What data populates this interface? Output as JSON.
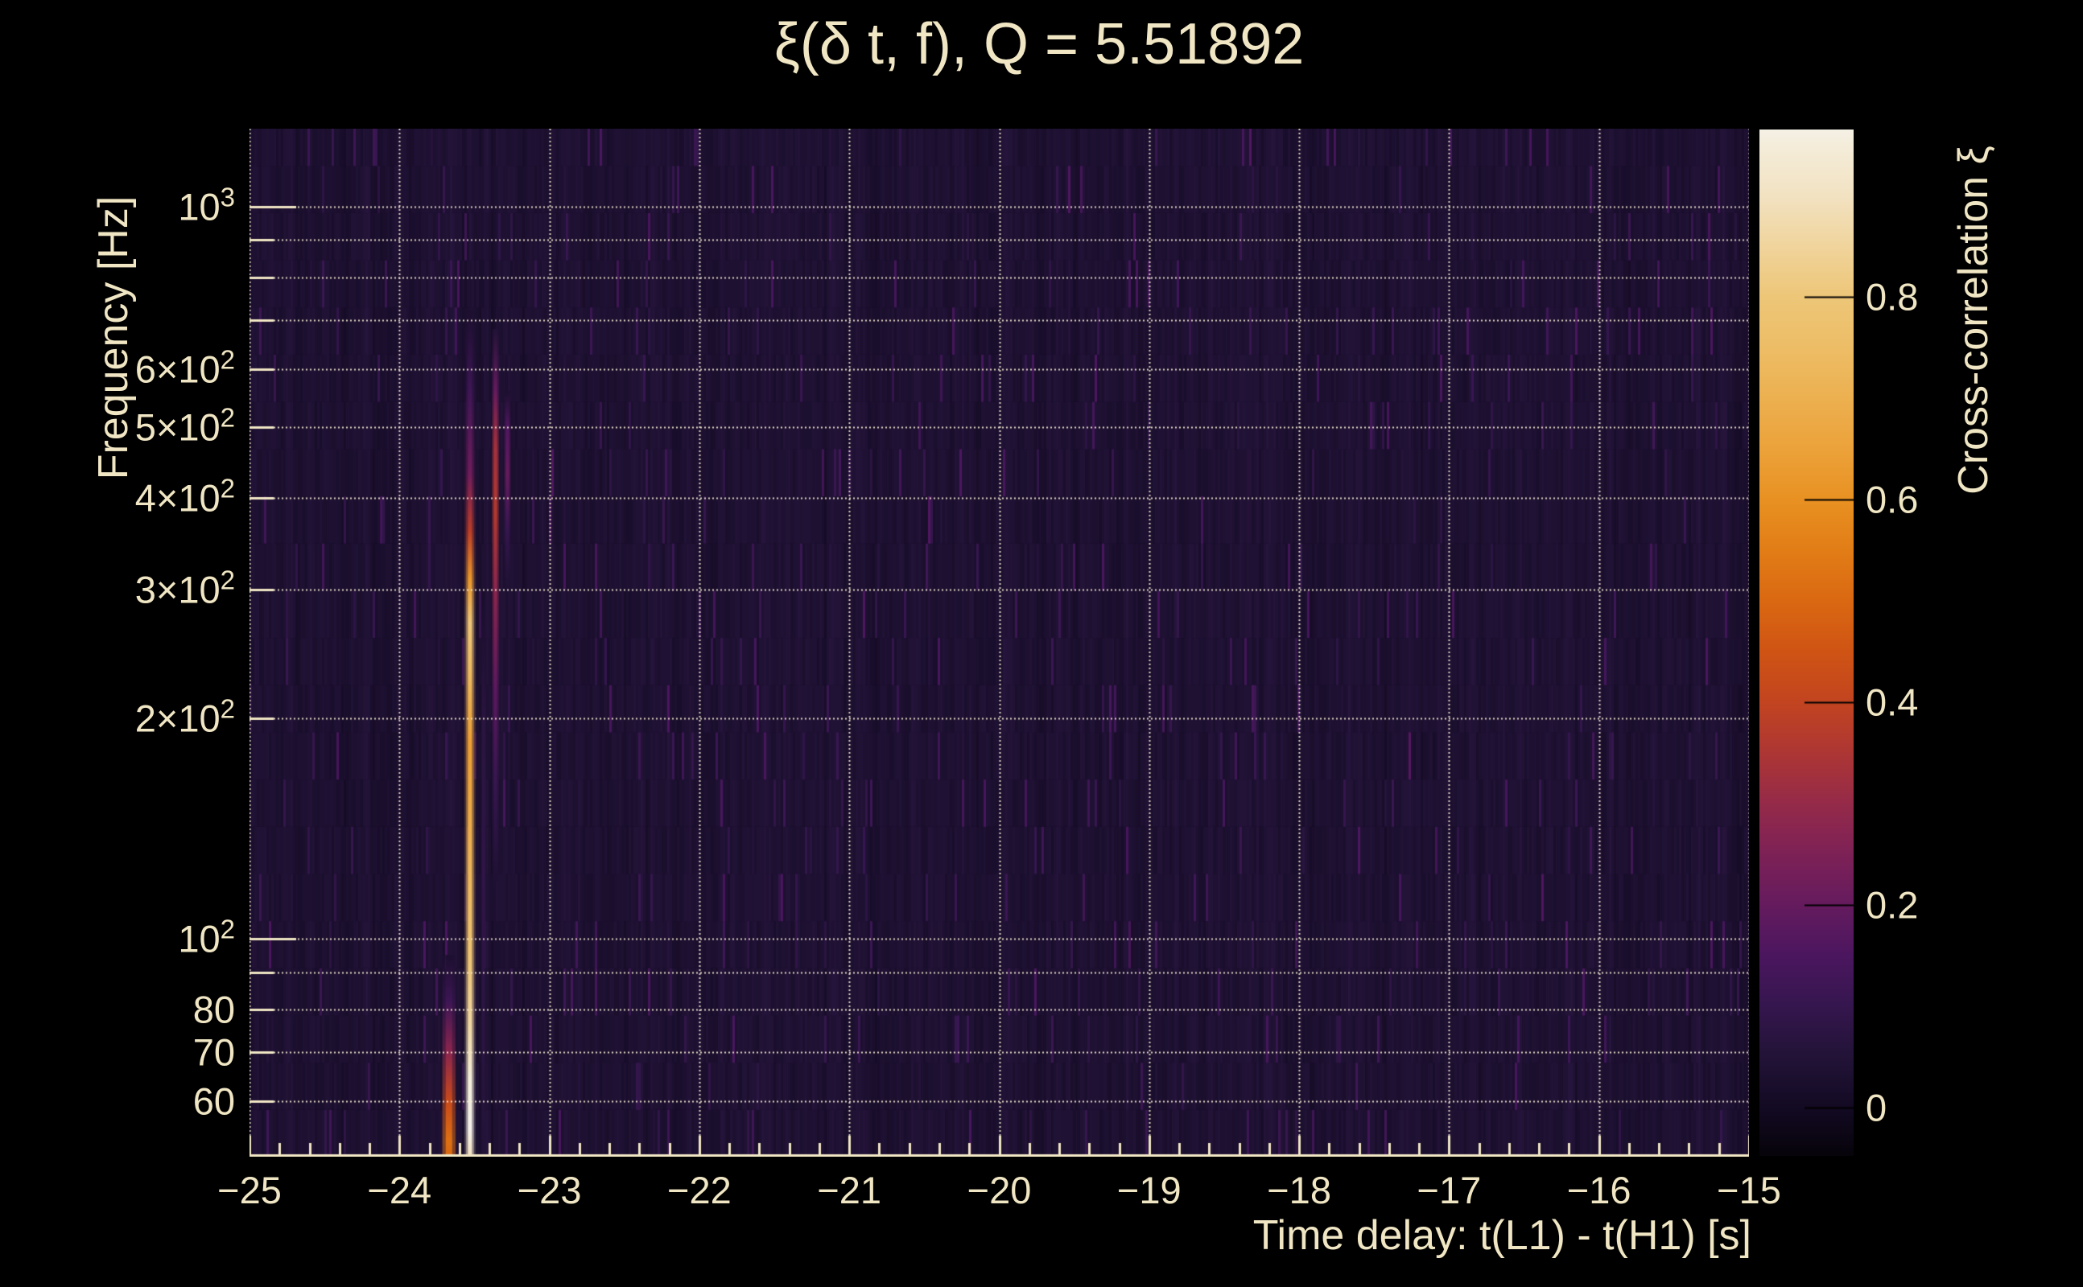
{
  "colors": {
    "background": "#000000",
    "text": "#f0e6c4",
    "grid": "#f3ead0",
    "axis": "#f0e6c4",
    "colorbar_tick": "#000000",
    "heatmap_base": "#1d1130"
  },
  "chart_data": {
    "type": "heatmap",
    "title": "ξ(δ t, f), Q = 5.51892",
    "xlabel": "Time delay: t(L1) - t(H1) [s]",
    "ylabel": "Frequency [Hz]",
    "colorbar_label": "Cross-correlation ξ",
    "x_range": [
      -25,
      -15
    ],
    "y_range_hz": [
      50.4,
      1277
    ],
    "y_scale": "log",
    "grid": true,
    "legend_position": "right-colorbar",
    "x_ticks": [
      {
        "t": -25,
        "label": "−25"
      },
      {
        "t": -24,
        "label": "−24"
      },
      {
        "t": -23,
        "label": "−23"
      },
      {
        "t": -22,
        "label": "−22"
      },
      {
        "t": -21,
        "label": "−21"
      },
      {
        "t": -20,
        "label": "−20"
      },
      {
        "t": -19,
        "label": "−19"
      },
      {
        "t": -18,
        "label": "−18"
      },
      {
        "t": -17,
        "label": "−17"
      },
      {
        "t": -16,
        "label": "−16"
      },
      {
        "t": -15,
        "label": "−15"
      }
    ],
    "x_minor_tick_step": 0.2,
    "y_ticks": [
      {
        "f": 1000,
        "base": "10",
        "exp": "3",
        "decade": true
      },
      {
        "f": 600,
        "base": "6×10",
        "exp": "2",
        "decade": false
      },
      {
        "f": 500,
        "base": "5×10",
        "exp": "2",
        "decade": false
      },
      {
        "f": 400,
        "base": "4×10",
        "exp": "2",
        "decade": false
      },
      {
        "f": 300,
        "base": "3×10",
        "exp": "2",
        "decade": false
      },
      {
        "f": 200,
        "base": "2×10",
        "exp": "2",
        "decade": false
      },
      {
        "f": 100,
        "base": "10",
        "exp": "2",
        "decade": true
      },
      {
        "f": 80,
        "base": "80",
        "exp": "",
        "decade": false
      },
      {
        "f": 70,
        "base": "70",
        "exp": "",
        "decade": false
      },
      {
        "f": 60,
        "base": "60",
        "exp": "",
        "decade": false
      }
    ],
    "y_minor_gridlines_hz": [
      90,
      700,
      800,
      900
    ],
    "colorbar_ticks": [
      {
        "v": 0.8,
        "label": "0.8"
      },
      {
        "v": 0.6,
        "label": "0.6"
      },
      {
        "v": 0.4,
        "label": "0.4"
      },
      {
        "v": 0.2,
        "label": "0.2"
      },
      {
        "v": 0,
        "label": "0"
      }
    ],
    "color_range": [
      -0.048,
      0.965
    ],
    "colormap_stops": [
      [
        -0.05,
        "#060309"
      ],
      [
        0.0,
        "#130a23"
      ],
      [
        0.05,
        "#221337"
      ],
      [
        0.1,
        "#35164e"
      ],
      [
        0.15,
        "#4b165f"
      ],
      [
        0.2,
        "#651b5e"
      ],
      [
        0.25,
        "#7d2156"
      ],
      [
        0.3,
        "#952a49"
      ],
      [
        0.35,
        "#ad3634"
      ],
      [
        0.4,
        "#c24420"
      ],
      [
        0.45,
        "#cf5414"
      ],
      [
        0.5,
        "#da6812"
      ],
      [
        0.55,
        "#e27d16"
      ],
      [
        0.6,
        "#e89122"
      ],
      [
        0.65,
        "#eca23a"
      ],
      [
        0.7,
        "#ecb050"
      ],
      [
        0.75,
        "#edbd66"
      ],
      [
        0.8,
        "#edc678"
      ],
      [
        0.85,
        "#f0d49c"
      ],
      [
        0.9,
        "#f2e2c2"
      ],
      [
        0.95,
        "#f4edda"
      ],
      [
        0.97,
        "#f5f1e9"
      ]
    ],
    "features": [
      {
        "name": "primary-streak",
        "t": -23.53,
        "core_w": 5,
        "glow_w": 14,
        "stops": [
          [
            720,
            0.03
          ],
          [
            560,
            0.12
          ],
          [
            430,
            0.22
          ],
          [
            360,
            0.38
          ],
          [
            310,
            0.62
          ],
          [
            270,
            0.8
          ],
          [
            230,
            0.74
          ],
          [
            185,
            0.64
          ],
          [
            150,
            0.68
          ],
          [
            115,
            0.74
          ],
          [
            92,
            0.8
          ],
          [
            76,
            0.86
          ],
          [
            64,
            0.95
          ],
          [
            55,
            0.97
          ],
          [
            50.5,
            0.9
          ]
        ]
      },
      {
        "name": "secondary-streak",
        "t": -23.36,
        "core_w": 4,
        "glow_w": 9,
        "stops": [
          [
            680,
            0.05
          ],
          [
            560,
            0.2
          ],
          [
            470,
            0.33
          ],
          [
            380,
            0.36
          ],
          [
            300,
            0.28
          ],
          [
            220,
            0.18
          ],
          [
            160,
            0.1
          ],
          [
            120,
            0.04
          ]
        ]
      },
      {
        "name": "tertiary-line",
        "t": -23.28,
        "core_w": 4,
        "glow_w": 6,
        "stops": [
          [
            560,
            0.03
          ],
          [
            500,
            0.16
          ],
          [
            430,
            0.2
          ],
          [
            360,
            0.1
          ],
          [
            300,
            0.04
          ]
        ]
      },
      {
        "name": "low-crimson-streak",
        "t": -23.67,
        "core_w": 8,
        "glow_w": 17,
        "stops": [
          [
            95,
            0.03
          ],
          [
            82,
            0.12
          ],
          [
            70,
            0.28
          ],
          [
            60,
            0.42
          ],
          [
            53,
            0.52
          ],
          [
            50.5,
            0.5
          ]
        ]
      },
      {
        "name": "faint-companion",
        "t": -23.44,
        "core_w": 3,
        "glow_w": 5,
        "stops": [
          [
            300,
            0.02
          ],
          [
            200,
            0.07
          ],
          [
            120,
            0.09
          ],
          [
            70,
            0.07
          ],
          [
            50.5,
            0.05
          ]
        ]
      }
    ],
    "noise": {
      "seed": 1337,
      "band_ratio": 1.16,
      "base_value": 0.02
    }
  }
}
